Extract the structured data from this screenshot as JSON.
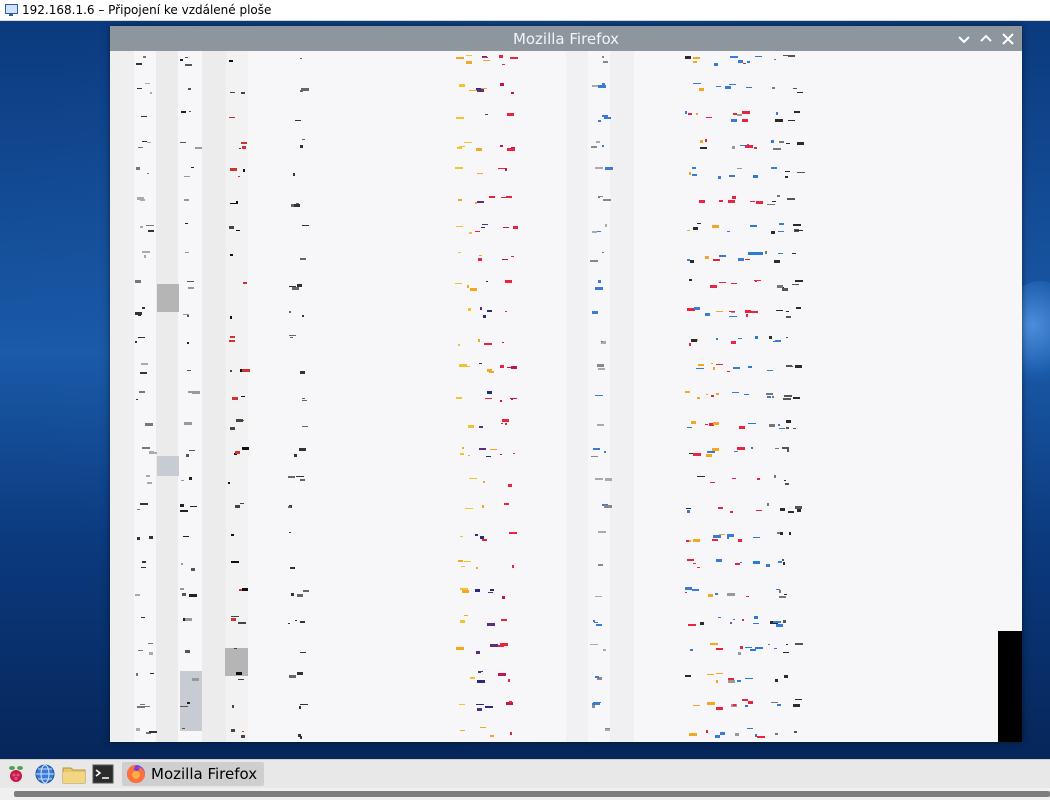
{
  "rdp_window": {
    "title": "192.168.1.6 – Připojení ke vzdálené ploše",
    "icon": "remote-desktop-icon"
  },
  "firefox": {
    "title": "Mozilla Firefox",
    "controls": [
      "minimize-icon",
      "maximize-icon",
      "close-icon"
    ],
    "content_state": "rendering-glitch"
  },
  "taskbar": {
    "launchers": [
      "raspberry-pi-menu-icon",
      "web-browser-icon",
      "file-manager-icon",
      "terminal-icon"
    ],
    "active_task_label": "Mozilla Firefox",
    "active_task_icon": "firefox-icon"
  },
  "colors": {
    "desktop": "#0d3f86",
    "titlebar": "#8d959d",
    "content_bg": "#f7f7f9",
    "taskbar": "#e8e8e8"
  }
}
